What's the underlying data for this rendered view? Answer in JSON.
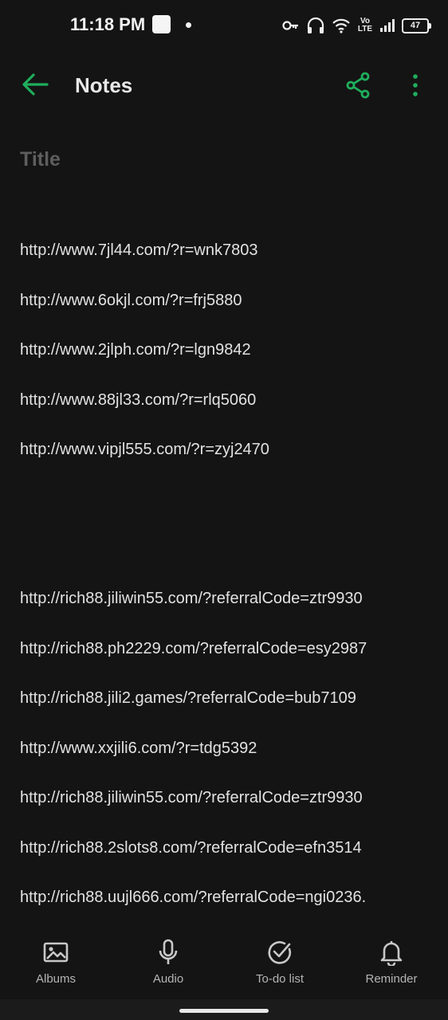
{
  "status_bar": {
    "time": "11:18 PM",
    "battery": "47",
    "network": "Vo\nLTE"
  },
  "app_bar": {
    "title": "Notes"
  },
  "note": {
    "title_placeholder": "Title",
    "lines": [
      "http://www.7jl44.com/?r=wnk7803",
      "http://www.6okjl.com/?r=frj5880",
      "http://www.2jlph.com/?r=lgn9842",
      "http://www.88jl33.com/?r=rlq5060",
      "http://www.vipjl555.com/?r=zyj2470",
      "http://rich88.jiliwin55.com/?referralCode=ztr9930",
      "http://rich88.ph2229.com/?referralCode=esy2987",
      "http://rich88.jili2.games/?referralCode=bub7109",
      "http://www.xxjili6.com/?r=tdg5392",
      "http://rich88.jiliwin55.com/?referralCode=ztr9930",
      "http://rich88.2slots8.com/?referralCode=efn3514",
      "http://rich88.uujl666.com/?referralCode=ngi0236."
    ]
  },
  "toolbar": {
    "albums": "Albums",
    "audio": "Audio",
    "todo": "To-do list",
    "reminder": "Reminder"
  },
  "colors": {
    "accent": "#1fae5c",
    "background": "#141414",
    "text": "#e2e2e2"
  },
  "icons": {
    "back": "arrow-left-icon",
    "share": "share-icon",
    "more": "more-vertical-icon",
    "albums": "image-icon",
    "audio": "microphone-icon",
    "todo": "check-circle-icon",
    "reminder": "bell-icon"
  }
}
